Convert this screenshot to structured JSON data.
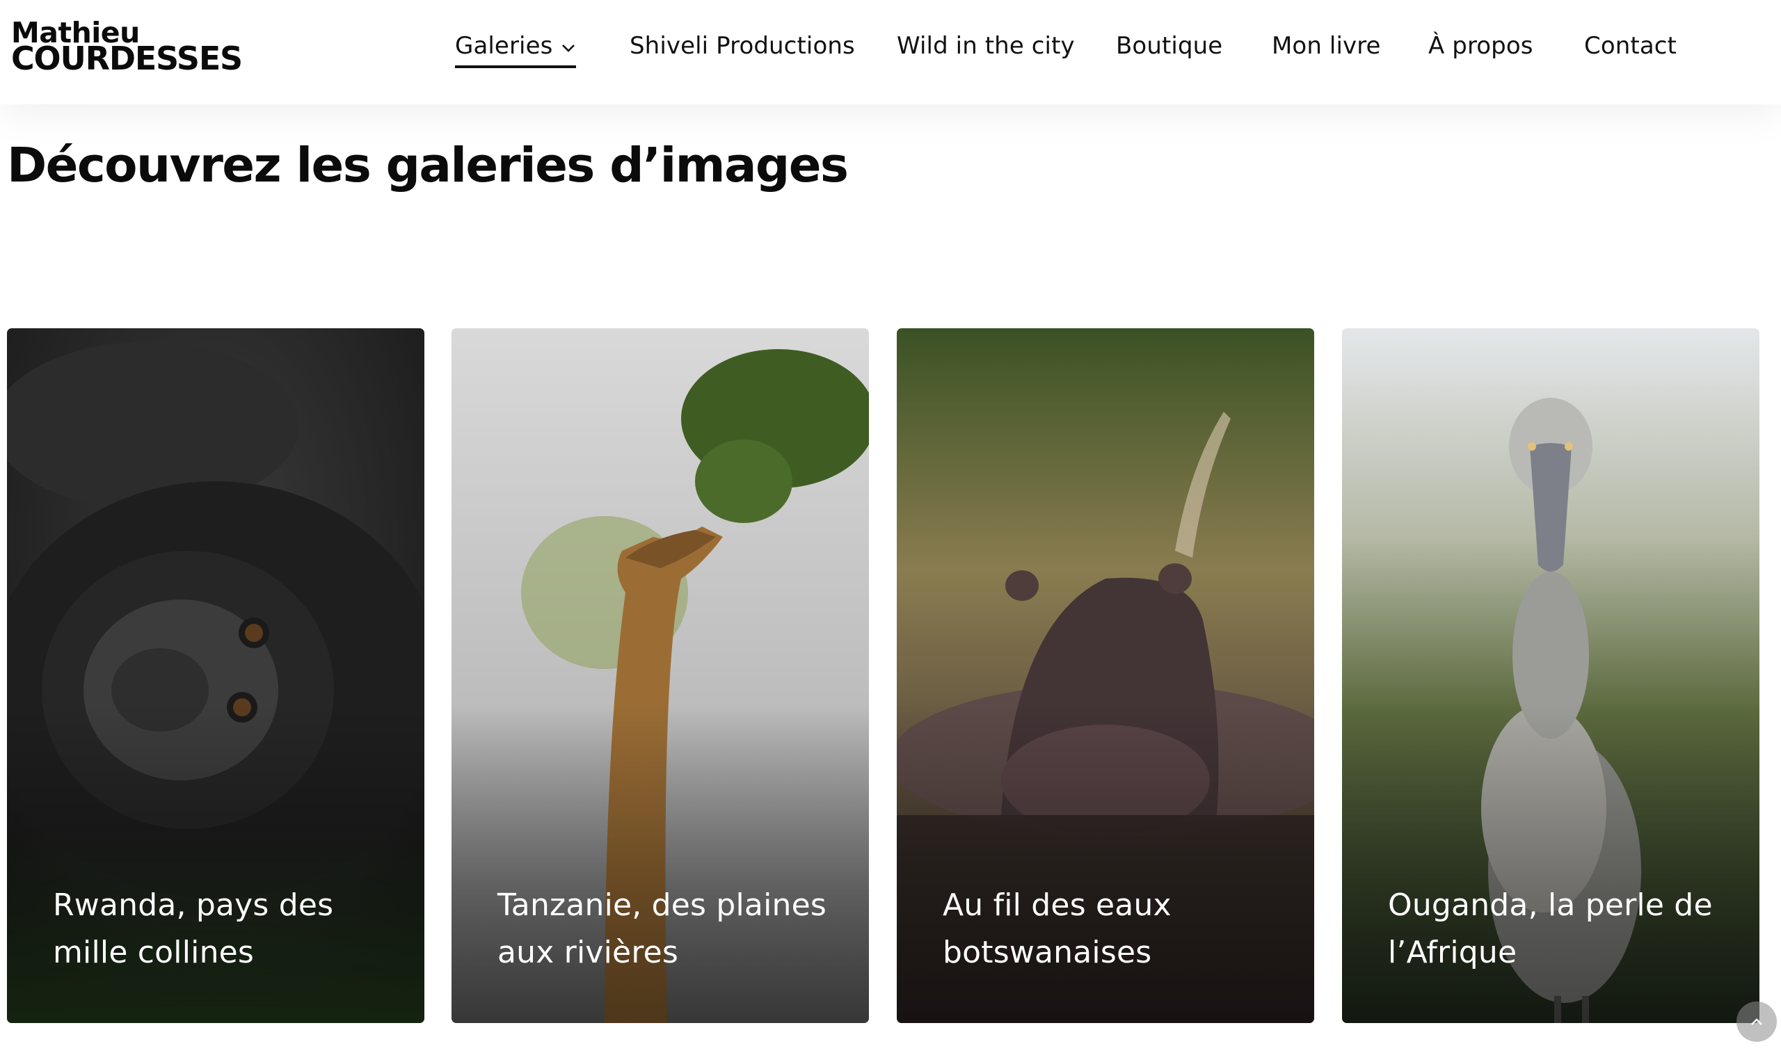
{
  "logo": {
    "first_name": "Mathieu",
    "last_name": "COURDESSES"
  },
  "nav": {
    "items": [
      {
        "label": "Galeries"
      },
      {
        "label": "Shiveli Productions"
      },
      {
        "label": "Wild in the city"
      },
      {
        "label": "Boutique"
      },
      {
        "label": "Mon livre"
      },
      {
        "label": "À propos"
      },
      {
        "label": "Contact"
      }
    ]
  },
  "page": {
    "title": "Découvrez les galeries d’images"
  },
  "galleries": [
    {
      "title": "Rwanda, pays des mille collines",
      "icon": "gorilla-photo"
    },
    {
      "title": "Tanzanie, des plaines aux rivières",
      "icon": "giraffe-photo"
    },
    {
      "title": "Au fil des eaux botswanaises",
      "icon": "hippo-photo"
    },
    {
      "title": "Ouganda, la perle de l’Afrique",
      "icon": "shoebill-photo"
    }
  ],
  "colors": {
    "title_underline": "#8ec594",
    "text": "#111111",
    "caption": "#ffffff"
  }
}
